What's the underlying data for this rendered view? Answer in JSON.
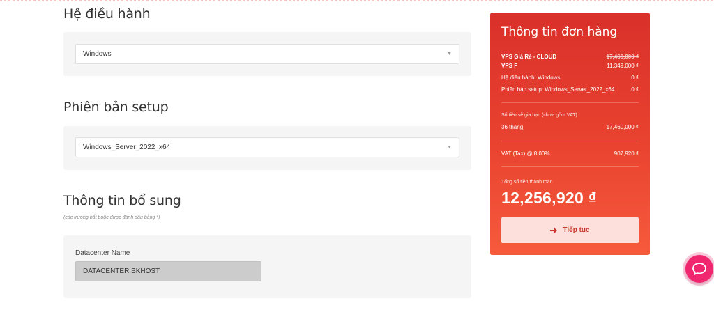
{
  "os_section": {
    "title": "Hệ điều hành",
    "selected": "Windows"
  },
  "setup_section": {
    "title": "Phiên bản setup",
    "selected": "Windows_Server_2022_x64"
  },
  "extra_section": {
    "title": "Thông tin bổ sung",
    "note": "(các trường bắt buộc được đánh dấu bằng *)",
    "datacenter_label": "Datacenter Name",
    "datacenter_value": "DATACENTER BKHOST"
  },
  "order": {
    "title": "Thông tin đơn hàng",
    "product_name": "VPS Giá Rẻ - CLOUD",
    "product_old_price": "17,460,000 ₫",
    "plan_name": "VPS F",
    "plan_price": "11,349,000 ₫",
    "os_line": "Hệ điều hành: Windows",
    "os_price": "0 ₫",
    "setup_line": "Phiên bản setup: Windows_Server_2022_x64",
    "setup_price": "0 ₫",
    "renew_label": "Số tiền sẽ gia hạn (chưa gồm VAT)",
    "term": "36 tháng",
    "term_price": "17,460,000 ₫",
    "vat_label": "VAT (Tax) @ 8.00%",
    "vat_price": "907,920 ₫",
    "total_label": "Tổng số tiền thanh toán",
    "total": "12,256,920 ₫",
    "continue_label": "Tiếp tục"
  },
  "colors": {
    "accent": "#e8412f",
    "chat": "#f0266f"
  },
  "icons": {
    "caret": "chevron-down-icon",
    "continue": "arrow-right-icon",
    "chat": "chat-bubble-icon"
  }
}
